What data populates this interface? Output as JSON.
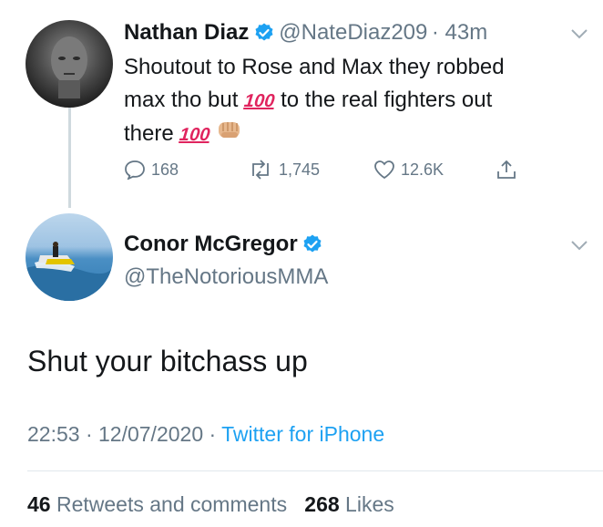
{
  "reply_to": {
    "name": "Nathan Diaz",
    "handle": "@NateDiaz209",
    "time": "· 43m",
    "text_line1": "Shoutout to Rose and Max they robbed",
    "text_line2_a": "max tho but",
    "text_line2_b": "to the real fighters out",
    "text_line3": "there",
    "emoji_100": "100",
    "reply_count": "168",
    "retweet_count": "1,745",
    "like_count": "12.6K"
  },
  "tweet": {
    "name": "Conor McGregor",
    "handle": "@TheNotoriousMMA",
    "text": "Shut your bitchass up",
    "time": "22:53 · 12/07/2020",
    "separator": "·",
    "source": "Twitter for iPhone",
    "retweets_count": "46",
    "retweets_label": "Retweets and comments",
    "likes_count": "268",
    "likes_label": "Likes"
  },
  "colors": {
    "verified": "#1da1f2",
    "link": "#1da1f2",
    "secondary": "#657786",
    "emoji_100": "#e0245e"
  }
}
